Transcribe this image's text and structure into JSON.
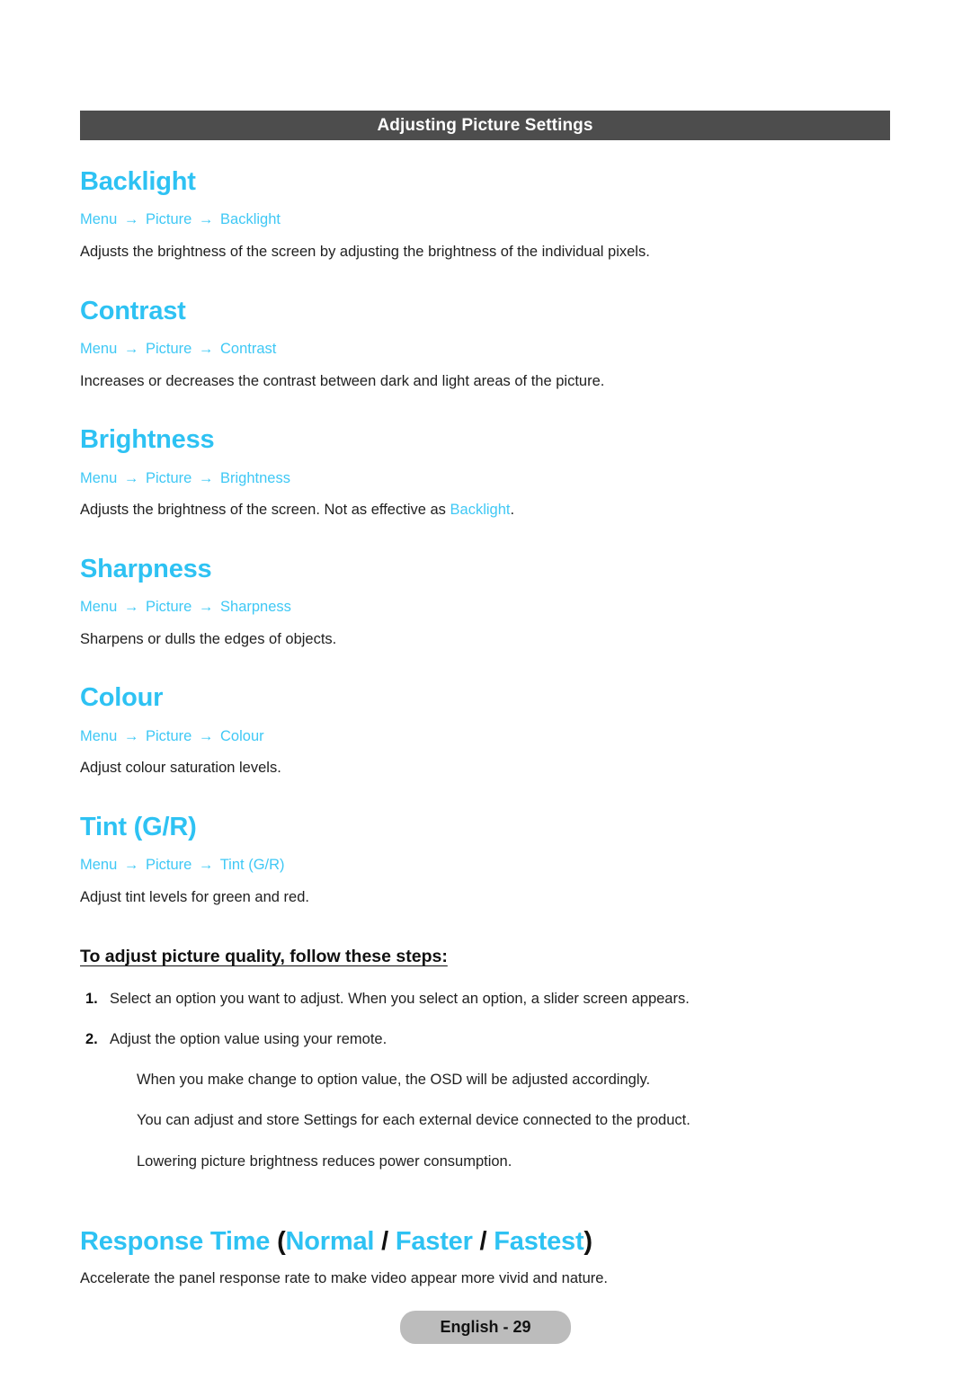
{
  "section": {
    "title": "Adjusting Picture Settings"
  },
  "arrow_glyph": "→",
  "colors": {
    "accent_blue": "#2EC2F3",
    "breadcrumb_blue": "#3FC8F5",
    "section_bar_bg": "#4D4D4D",
    "footer_pill_bg": "#BCBCBC",
    "body_text": "#1F1F1F"
  },
  "sections": [
    {
      "heading": "Backlight",
      "breadcrumb": [
        "Menu",
        "Picture",
        "Backlight"
      ],
      "description": "Adjusts the brightness of the screen by adjusting the brightness of the individual pixels."
    },
    {
      "heading": "Contrast",
      "breadcrumb": [
        "Menu",
        "Picture",
        "Contrast"
      ],
      "description": "Increases or decreases the contrast between dark and light areas of the picture."
    },
    {
      "heading": "Brightness",
      "breadcrumb": [
        "Menu",
        "Picture",
        "Brightness"
      ],
      "description_pre": "Adjusts the brightness of the screen. Not as effective as ",
      "description_highlight": "Backlight",
      "description_post": "."
    },
    {
      "heading": "Sharpness",
      "breadcrumb": [
        "Menu",
        "Picture",
        "Sharpness"
      ],
      "description": "Sharpens or dulls the edges of objects."
    },
    {
      "heading": "Colour",
      "breadcrumb": [
        "Menu",
        "Picture",
        "Colour"
      ],
      "description": "Adjust colour saturation levels."
    },
    {
      "heading": "Tint (G/R)",
      "breadcrumb": [
        "Menu",
        "Picture",
        "Tint (G/R)"
      ],
      "description": "Adjust tint levels for green and red."
    }
  ],
  "steps": {
    "title": "To adjust picture quality, follow these steps:",
    "items": [
      {
        "number": "1.",
        "text": "Select an option you want to adjust. When you select an option, a slider screen appears."
      },
      {
        "number": "2.",
        "text": "Adjust the option value using your remote."
      }
    ],
    "notes": [
      "When you make change to option value, the OSD will be adjusted accordingly.",
      "You can adjust and store Settings for each external device connected to the product.",
      "Lowering picture brightness reduces power consumption."
    ]
  },
  "response_time": {
    "title_main": "Response Time",
    "paren_open": " (",
    "option_1": "Normal",
    "sep_1": " / ",
    "option_2": "Faster",
    "sep_2": " / ",
    "option_3": "Fastest",
    "paren_close": ")",
    "description": "Accelerate the panel response rate to make video appear more vivid and nature."
  },
  "footer": {
    "page_label": "English - 29"
  }
}
